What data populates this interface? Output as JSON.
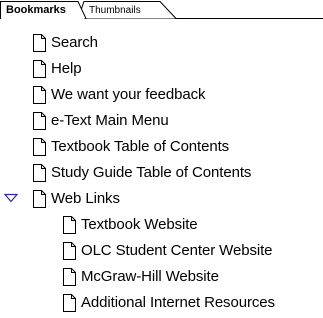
{
  "tabs": {
    "bookmarks_label": "Bookmarks",
    "thumbnails_label": "Thumbnails",
    "active": "Bookmarks"
  },
  "bookmarks": {
    "items": [
      {
        "label": "Search",
        "icon": "page-icon"
      },
      {
        "label": "Help",
        "icon": "page-icon"
      },
      {
        "label": "We want your feedback",
        "icon": "page-icon"
      },
      {
        "label": "e-Text Main Menu",
        "icon": "page-icon"
      },
      {
        "label": "Textbook Table of Contents",
        "icon": "page-icon"
      },
      {
        "label": "Study Guide Table of Contents",
        "icon": "page-icon"
      },
      {
        "label": "Web Links",
        "icon": "page-icon",
        "expanded": true,
        "expander_icon": "triangle-down-icon",
        "children": [
          {
            "label": "Textbook Website",
            "icon": "page-icon"
          },
          {
            "label": "OLC Student Center Website",
            "icon": "page-icon"
          },
          {
            "label": "McGraw-Hill Website",
            "icon": "page-icon"
          },
          {
            "label": "Additional Internet Resources",
            "icon": "page-icon"
          }
        ]
      }
    ]
  },
  "colors": {
    "expander": "#2a2aa8",
    "tab_border": "#000000",
    "inactive_tab_fill": "#ffffff"
  }
}
